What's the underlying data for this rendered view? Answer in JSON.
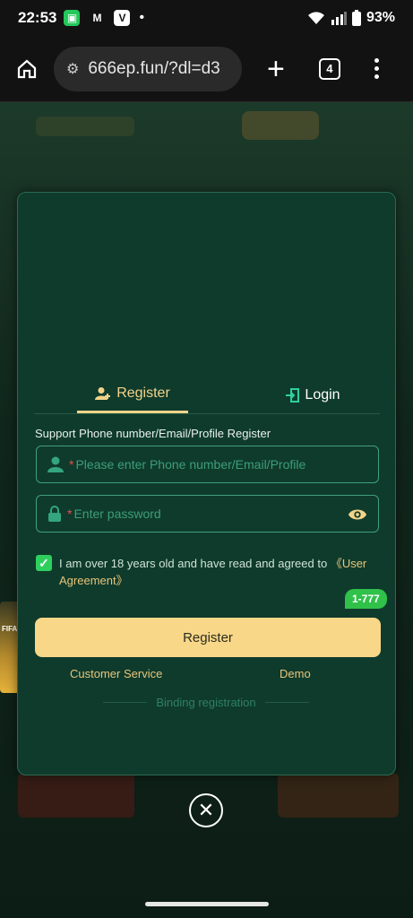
{
  "status_bar": {
    "time": "22:53",
    "battery": "93%",
    "indicator_dot": "•"
  },
  "browser": {
    "url": "666ep.fun/?dl=d3",
    "tab_count": "4"
  },
  "modal": {
    "tabs": {
      "register": "Register",
      "login": "Login"
    },
    "support_text": "Support Phone number/Email/Profile Register",
    "fields": {
      "account": {
        "required_mark": "*",
        "placeholder": "Please enter Phone number/Email/Profile"
      },
      "password": {
        "required_mark": "*",
        "placeholder": "Enter password"
      }
    },
    "agreement": {
      "text": "I am over 18 years old and have read and agreed to ",
      "link": "《User Agreement》"
    },
    "chip": "1-777",
    "register_button": "Register",
    "customer_service": "Customer Service",
    "demo": "Demo",
    "binding": "Binding registration"
  },
  "side_badge": {
    "text": "FIFA"
  },
  "colors": {
    "accent": "#f2d38a",
    "modal_bg": "#0f3b2c",
    "field_border": "#3fa07e",
    "checkbox": "#2fcf5e",
    "chip": "#30c14a"
  }
}
